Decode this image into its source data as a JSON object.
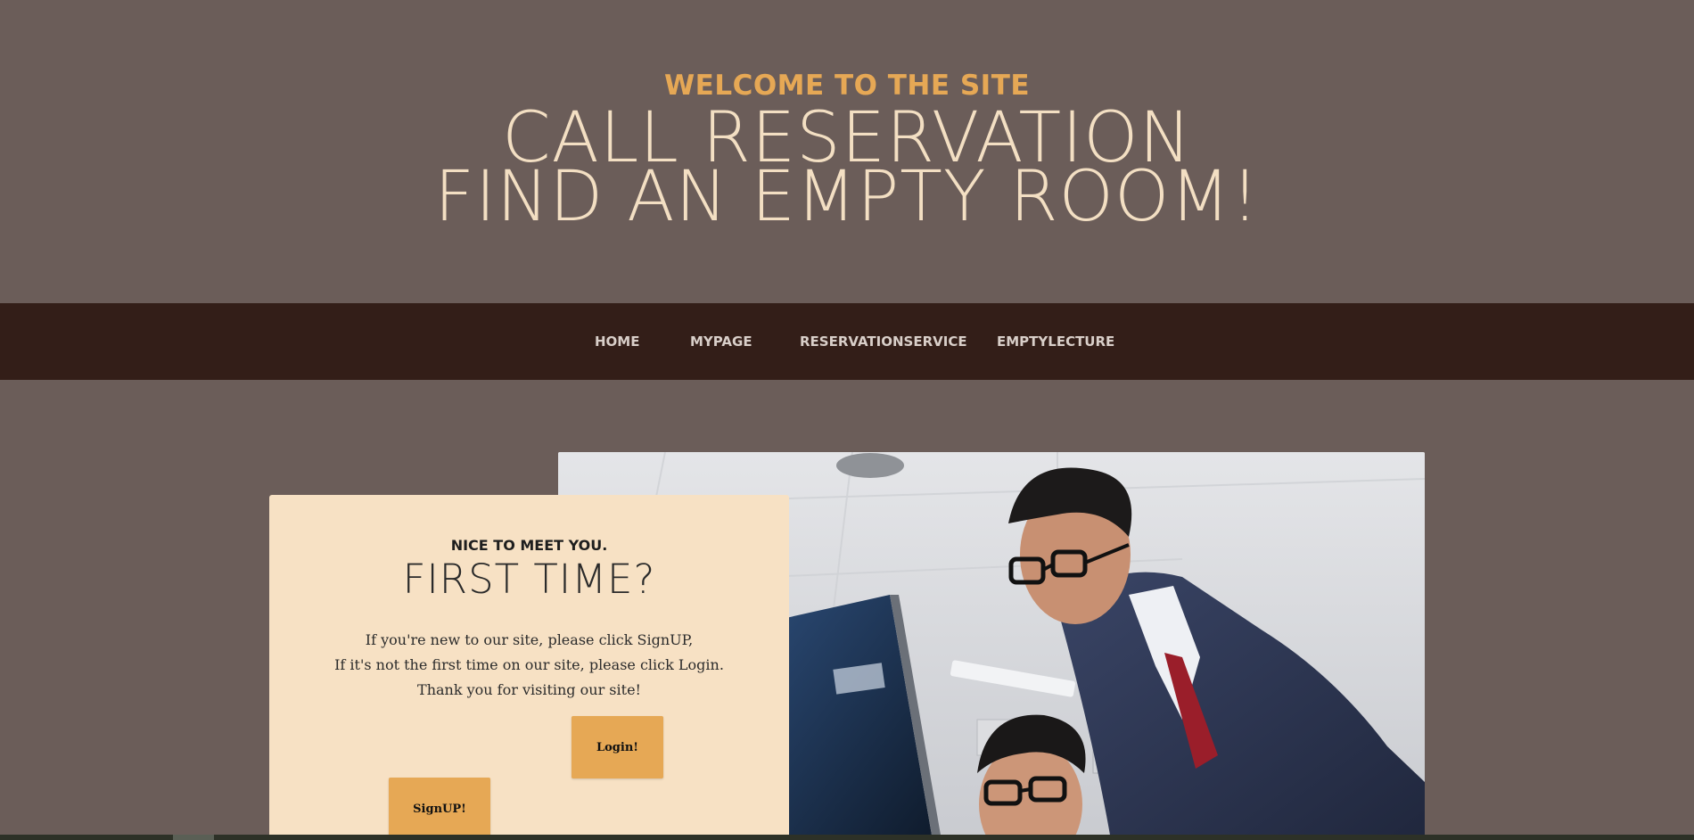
{
  "header": {
    "eyebrow": "WELCOME TO THE SITE",
    "title_line1": "CALL RESERVATION",
    "title_line2": "FIND AN EMPTY ROOM!"
  },
  "nav": {
    "items": [
      {
        "label": "HOME"
      },
      {
        "label": "MYPAGE"
      },
      {
        "label": "RESERVATIONSERVICE"
      },
      {
        "label": "EMPTYLECTURE"
      }
    ]
  },
  "card": {
    "subtitle": "NICE TO MEET YOU.",
    "title": "FIRST TIME?",
    "line1": "If you're new to our site, please click SignUP,",
    "line2": "If it's not the first time on our site, please click Login.",
    "line3": "Thank you for visiting our site!",
    "login_label": "Login!",
    "signup_label": "SignUP!"
  },
  "colors": {
    "background": "#6b5d59",
    "nav_background": "#331e18",
    "accent": "#e6a855",
    "title_cream": "#f3dfc3",
    "card_background": "#f7e1c4"
  },
  "image": {
    "icon": "office-photo-two-men-at-computer"
  }
}
